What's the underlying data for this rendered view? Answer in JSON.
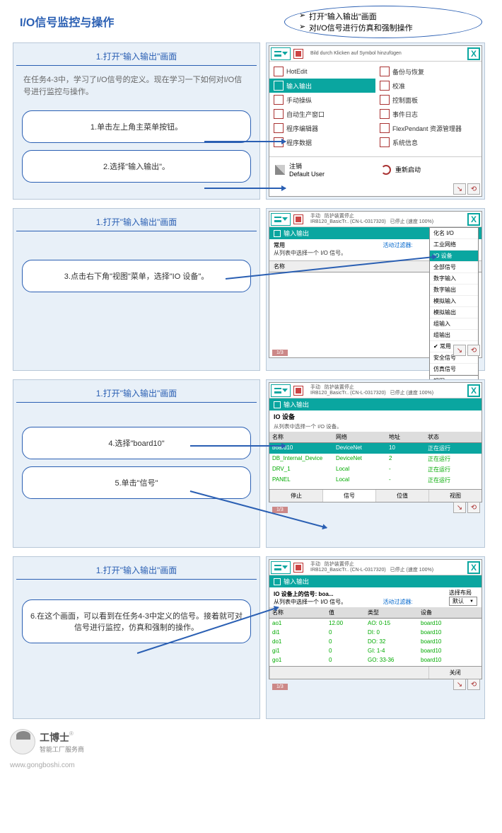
{
  "title": "I/O信号监控与操作",
  "intro": {
    "l1": "打开\"输入输出\"画面",
    "l2": "对I/O信号进行仿真和强制操作"
  },
  "panels": {
    "h": "1.打开\"输入输出\"画面"
  },
  "para1": "在任务4-3中，学习了I/O信号的定义。现在学习一下如何对I/O信号进行监控与操作。",
  "b1": "1.单击左上角主菜单按钮。",
  "b2": "2.选择\"输入输出\"。",
  "b3": "3.点击右下角\"视图\"菜单，选择\"IO 设备\"。",
  "b4": "4.选择\"board10\"",
  "b5": "5.单击\"信号\"",
  "b6": "6.在这个画面，可以看到在任务4-3中定义的信号。接着就可对信号进行监控，仿真和强制的操作。",
  "top_bar": "Bild durch Klicken auf Symbol hinzufügen",
  "status_line1": "手动",
  "status_line2": "IRB120_BasicTr.. (CN-L-0317320)",
  "status_line3": "防护装置停止",
  "status_line4": "已停止 (速度 100%)",
  "menu": {
    "hotedit": "HotEdit",
    "io": "输入输出",
    "manual": "手动操纵",
    "auto": "自动生产窗口",
    "prgedit": "程序编辑器",
    "prgdata": "程序数据",
    "backup": "备份与恢复",
    "calib": "校准",
    "panel": "控制面板",
    "log": "事件日志",
    "flex": "FlexPendant 资源管理器",
    "sys": "系统信息",
    "logout_t": "注销",
    "logout_u": "Default User",
    "restart": "重新启动"
  },
  "crumb_io": "输入输出",
  "filter": {
    "usual": "常用",
    "hint": "从列表中选择一个 I/O 信号。",
    "active": "活动过滤器:",
    "sel": "选择布局",
    "def": "默认"
  },
  "col_name": "名称",
  "viewmenu": {
    "a": "化名 I/O",
    "b": "工业网络",
    "c": "IO 设备",
    "d": "全部信号",
    "e": "数字输入",
    "f": "数字输出",
    "g": "模拟输入",
    "h": "模拟输出",
    "i": "组输入",
    "j": "组输出",
    "k": "常用",
    "l": "安全信号",
    "m": "仿真信号",
    "z": "视图"
  },
  "dev": {
    "title": "IO 设备",
    "hint": "从列表中选择一个 I/O 设备。",
    "h1": "名称",
    "h2": "网络",
    "h3": "地址",
    "h4": "状态",
    "r1": {
      "a": "board10",
      "b": "DeviceNet",
      "c": "10",
      "d": "正在运行"
    },
    "r2": {
      "a": "DB_Internal_Device",
      "b": "DeviceNet",
      "c": "2",
      "d": "正在运行"
    },
    "r3": {
      "a": "DRV_1",
      "b": "Local",
      "c": "-",
      "d": "正在运行"
    },
    "r4": {
      "a": "PANEL",
      "b": "Local",
      "c": "-",
      "d": "正在运行"
    }
  },
  "tabs": {
    "stop": "停止",
    "sig": "信号",
    "bit": "位值",
    "view": "视图",
    "close": "关闭"
  },
  "sig": {
    "title": "IO 设备上的信号: boa...",
    "hint": "从列表中选择一个 I/O 信号。",
    "h1": "名称",
    "h2": "值",
    "h3": "类型",
    "h4": "设备",
    "r1": {
      "a": "ao1",
      "b": "12.00",
      "c": "AO: 0-15",
      "d": "board10"
    },
    "r2": {
      "a": "di1",
      "b": "0",
      "c": "DI: 0",
      "d": "board10"
    },
    "r3": {
      "a": "do1",
      "b": "0",
      "c": "DO: 32",
      "d": "board10"
    },
    "r4": {
      "a": "gi1",
      "b": "0",
      "c": "GI: 1-4",
      "d": "board10"
    },
    "r5": {
      "a": "go1",
      "b": "0",
      "c": "GO: 33-36",
      "d": "board10"
    }
  },
  "task": "1/3",
  "logo": {
    "name": "工博士",
    "sub": "智能工厂服务商",
    "url": "www.gongboshi.com"
  }
}
